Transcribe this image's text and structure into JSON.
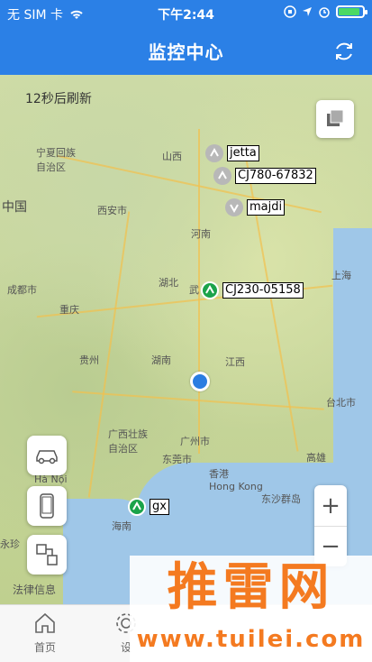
{
  "status_bar": {
    "carrier": "无 SIM 卡",
    "time": "下午2:44",
    "battery_level": 0.9
  },
  "header": {
    "title": "监控中心"
  },
  "map": {
    "refresh_text": "12秒后刷新",
    "labels": {
      "china": "中国",
      "shanxi": "山西",
      "ningxia": "宁夏回族\n自治区",
      "xian": "西安市",
      "henan": "河南",
      "hubei": "湖北",
      "chengdu": "成都市",
      "chongqing": "重庆",
      "guizhou": "贵州",
      "hunan": "湖南",
      "jiangxi": "江西",
      "shanghai": "上海",
      "guangzhou": "广州市",
      "dongguan": "东莞市",
      "hongkong": "香港\nHong Kong",
      "taiwan": "台北市",
      "kaohsiung": "高雄",
      "hanoi": "Hà Nội",
      "hainan": "海南",
      "guangxi": "广西壮族\n自治区",
      "dongsha": "东沙群岛",
      "yongzhen": "永珍",
      "wuhan": "武",
      "legal": "法律信息"
    },
    "vehicles": [
      {
        "name": "jetta",
        "status": "offline"
      },
      {
        "name": "CJ780-67832",
        "status": "offline"
      },
      {
        "name": "majdi",
        "status": "offline"
      },
      {
        "name": "CJ230-05158",
        "status": "online"
      },
      {
        "name": "gx",
        "status": "online"
      }
    ]
  },
  "tabs": [
    {
      "label": "首页"
    },
    {
      "label": "设"
    }
  ],
  "watermark": {
    "brand": "推雷网",
    "url": "www.tuilei.com"
  },
  "colors": {
    "primary": "#2b80e6",
    "online": "#1aa34a",
    "offline": "#b8b8b8",
    "brand": "#f47a20"
  }
}
